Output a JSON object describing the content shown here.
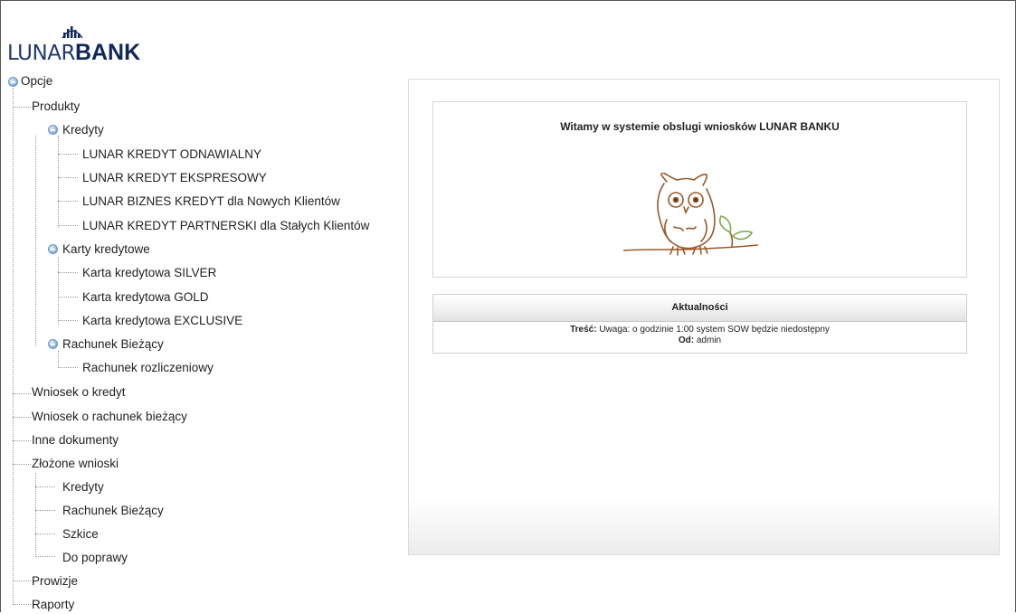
{
  "logo": {
    "thin": "LUNAR",
    "bold": "BANK"
  },
  "tree": {
    "root": "Opcje",
    "produkty": "Produkty",
    "kredyty": "Kredyty",
    "kredyty_items": [
      "LUNAR KREDYT ODNAWIALNY",
      "LUNAR KREDYT EKSPRESOWY",
      "LUNAR BIZNES KREDYT dla Nowych Klientów",
      "LUNAR KREDYT PARTNERSKI dla Stałych Klientów"
    ],
    "karty": "Karty kredytowe",
    "karty_items": [
      "Karta kredytowa SILVER",
      "Karta kredytowa GOLD",
      "Karta kredytowa EXCLUSIVE"
    ],
    "rachunek": "Rachunek Bieżący",
    "rachunek_items": [
      "Rachunek rozliczeniowy"
    ],
    "wniosek_kredyt": "Wniosek o kredyt",
    "wniosek_rachunek": "Wniosek o rachunek bieżący",
    "inne": "Inne dokumenty",
    "zlozone": "Złożone wnioski",
    "zlozone_items": [
      "Kredyty",
      "Rachunek Bieżący",
      "Szkice",
      "Do poprawy"
    ],
    "prowizje": "Prowizje",
    "raporty": "Raporty"
  },
  "welcome": {
    "title": "Witamy w systemie obslugi wniosków LUNAR BANKU"
  },
  "news": {
    "header": "Aktualności",
    "content_label": "Treść:",
    "content_text": "Uwaga: o godzinie 1:00 system SOW będzie niedostępny",
    "from_label": "Od:",
    "from_text": "admin"
  },
  "colors": {
    "logo_navy": "#10275a",
    "owl_brown": "#9a5a2a",
    "leaf_green": "#7ea84e",
    "toggle_blue": "#5a8fcb"
  }
}
